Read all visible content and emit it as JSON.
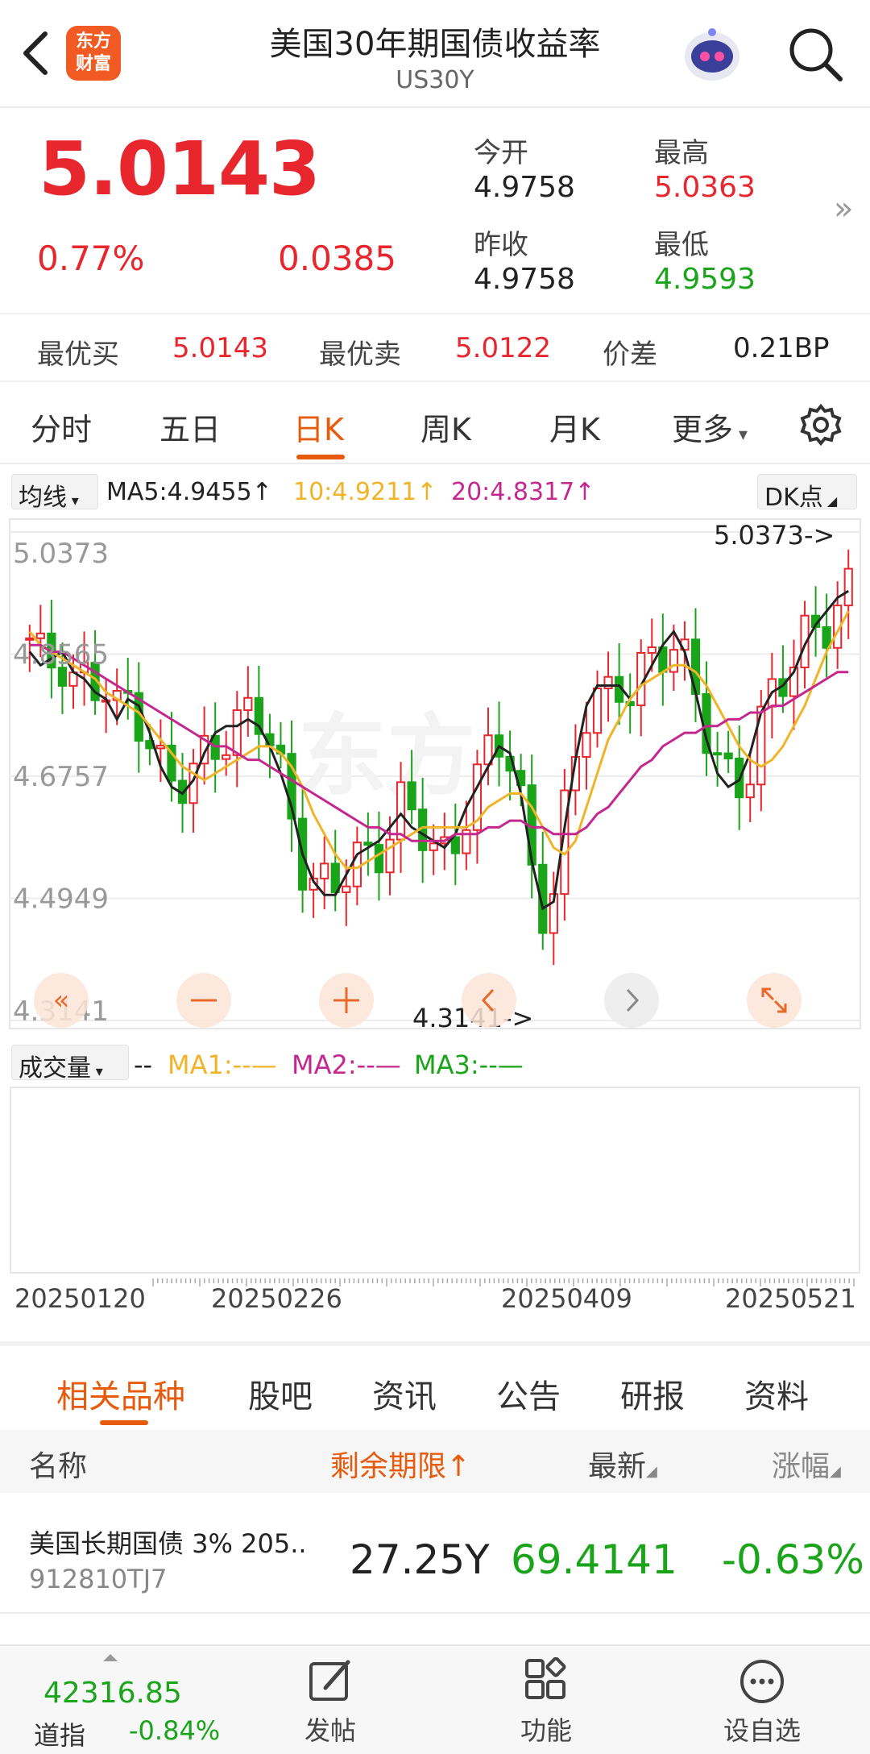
{
  "header": {
    "title": "美国30年期国债收益率",
    "subtitle": "US30Y",
    "logo_text_1": "东方",
    "logo_text_2": "财富"
  },
  "quote": {
    "last": "5.0143",
    "change_pct": "0.77%",
    "change": "0.0385",
    "open_label": "今开",
    "open": "4.9758",
    "high_label": "最高",
    "high": "5.0363",
    "prev_close_label": "昨收",
    "prev_close": "4.9758",
    "low_label": "最低",
    "low": "4.9593"
  },
  "bidask": {
    "bid_label": "最优买",
    "bid": "5.0143",
    "ask_label": "最优卖",
    "ask": "5.0122",
    "spread_label": "价差",
    "spread": "0.21BP"
  },
  "period_tabs": [
    "分时",
    "五日",
    "日K",
    "周K",
    "月K",
    "更多"
  ],
  "active_period": "日K",
  "ma_legend": {
    "selector": "均线",
    "ma5": "MA5:4.9455",
    "ma10": "10:4.9211",
    "ma20": "20:4.8317",
    "dk": "DK点"
  },
  "volume_legend": {
    "selector": "成交量",
    "dash": "--",
    "ma1": "MA1:--",
    "ma2": "MA2:--",
    "ma3": "MA3:--"
  },
  "colors": {
    "up": "#e8262d",
    "down": "#1aa41a",
    "ma5": "#222222",
    "ma10": "#f0b429",
    "ma20": "#c4288f",
    "accent": "#e85a0c"
  },
  "chart_data": {
    "type": "candlestick",
    "y_axis_labels": [
      "5.0373",
      "4.8565",
      "4.6757",
      "4.4949",
      "4.3141"
    ],
    "ylim": [
      4.3141,
      5.0373
    ],
    "max_annotation": "5.0373->",
    "min_annotation": "4.3141->",
    "x_labels": [
      "20250120",
      "20250226",
      "20250409",
      "20250521"
    ],
    "grid": true,
    "series": [
      {
        "name": "MA5",
        "values": [
          4.86,
          4.84,
          4.85,
          4.86,
          4.83,
          4.82,
          4.8,
          4.79,
          4.76,
          4.79,
          4.78,
          4.74,
          4.69,
          4.66,
          4.65,
          4.67,
          4.71,
          4.74,
          4.75,
          4.75,
          4.76,
          4.75,
          4.72,
          4.68,
          4.63,
          4.56,
          4.52,
          4.5,
          4.5,
          4.53,
          4.56,
          4.57,
          4.58,
          4.6,
          4.62,
          4.6,
          4.59,
          4.58,
          4.57,
          4.59,
          4.63,
          4.66,
          4.69,
          4.72,
          4.71,
          4.65,
          4.55,
          4.48,
          4.49,
          4.6,
          4.7,
          4.78,
          4.81,
          4.81,
          4.81,
          4.79,
          4.81,
          4.84,
          4.87,
          4.89,
          4.86,
          4.8,
          4.73,
          4.68,
          4.66,
          4.67,
          4.71,
          4.77,
          4.8,
          4.81,
          4.83,
          4.87,
          4.9,
          4.92,
          4.94,
          4.95
        ]
      },
      {
        "name": "10",
        "values": [
          4.89,
          4.87,
          4.86,
          4.85,
          4.84,
          4.83,
          4.82,
          4.8,
          4.79,
          4.78,
          4.77,
          4.75,
          4.73,
          4.71,
          4.69,
          4.68,
          4.67,
          4.68,
          4.69,
          4.7,
          4.71,
          4.72,
          4.72,
          4.71,
          4.69,
          4.66,
          4.62,
          4.59,
          4.56,
          4.54,
          4.54,
          4.55,
          4.56,
          4.57,
          4.58,
          4.59,
          4.6,
          4.6,
          4.6,
          4.6,
          4.6,
          4.61,
          4.63,
          4.64,
          4.65,
          4.65,
          4.63,
          4.6,
          4.57,
          4.56,
          4.58,
          4.63,
          4.68,
          4.73,
          4.76,
          4.79,
          4.81,
          4.82,
          4.83,
          4.84,
          4.84,
          4.83,
          4.81,
          4.78,
          4.75,
          4.72,
          4.7,
          4.69,
          4.7,
          4.72,
          4.75,
          4.78,
          4.82,
          4.86,
          4.89,
          4.92
        ]
      },
      {
        "name": "20",
        "values": [
          4.87,
          4.87,
          4.86,
          4.86,
          4.85,
          4.84,
          4.83,
          4.82,
          4.81,
          4.8,
          4.79,
          4.78,
          4.77,
          4.76,
          4.75,
          4.74,
          4.73,
          4.72,
          4.72,
          4.71,
          4.7,
          4.7,
          4.69,
          4.68,
          4.67,
          4.66,
          4.65,
          4.64,
          4.63,
          4.62,
          4.61,
          4.6,
          4.6,
          4.59,
          4.59,
          4.58,
          4.58,
          4.58,
          4.58,
          4.59,
          4.59,
          4.59,
          4.6,
          4.6,
          4.61,
          4.61,
          4.6,
          4.6,
          4.59,
          4.59,
          4.59,
          4.6,
          4.62,
          4.63,
          4.65,
          4.67,
          4.69,
          4.7,
          4.72,
          4.73,
          4.74,
          4.74,
          4.75,
          4.75,
          4.76,
          4.76,
          4.77,
          4.77,
          4.78,
          4.78,
          4.79,
          4.8,
          4.81,
          4.82,
          4.83,
          4.83
        ]
      }
    ]
  },
  "info_tabs": [
    "相关品种",
    "股吧",
    "资讯",
    "公告",
    "研报",
    "资料"
  ],
  "table": {
    "headers": {
      "name": "名称",
      "term": "剩余期限",
      "latest": "最新",
      "change": "涨幅"
    },
    "rows": [
      {
        "name": "美国长期国债 3% 205..",
        "code": "912810TJ7",
        "term": "27.25Y",
        "latest": "69.4141",
        "change": "-0.63%"
      }
    ]
  },
  "bottom_bar": {
    "index_value": "42316.85",
    "index_name": "道指",
    "index_pct": "-0.84%",
    "nav": [
      "发帖",
      "功能",
      "设自选"
    ]
  }
}
